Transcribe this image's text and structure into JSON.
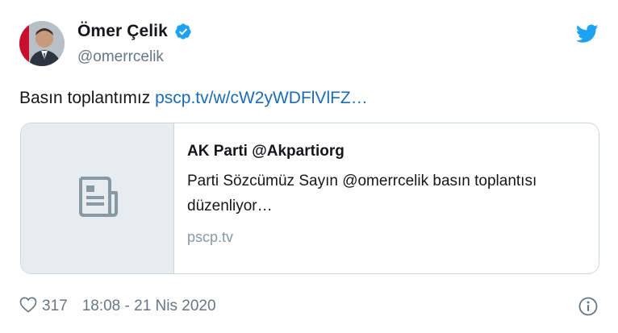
{
  "author": {
    "name": "Ömer Çelik",
    "handle": "@omerrcelik",
    "verified": true
  },
  "tweet": {
    "text": "Basın toplantımız ",
    "link": "pscp.tv/w/cW2yWDFlVlFZ…"
  },
  "card": {
    "title": "AK Parti @Akpartiorg",
    "description": "Parti Sözcümüz Sayın @omerrcelik basın toplantısı düzenliyor…",
    "domain": "pscp.tv",
    "thumbnail_icon": "document-icon"
  },
  "footer": {
    "like_count": "317",
    "timestamp": "18:08 - 21 Nis 2020"
  },
  "colors": {
    "brand_blue": "#1da1f2",
    "link_blue": "#1b6bb8",
    "muted_gray": "#657786",
    "border": "#ccd6dd",
    "thumb_bg": "#e6ecf0"
  },
  "icons": [
    "avatar",
    "verified-badge-icon",
    "twitter-bird-icon",
    "document-icon",
    "heart-icon",
    "info-icon"
  ]
}
